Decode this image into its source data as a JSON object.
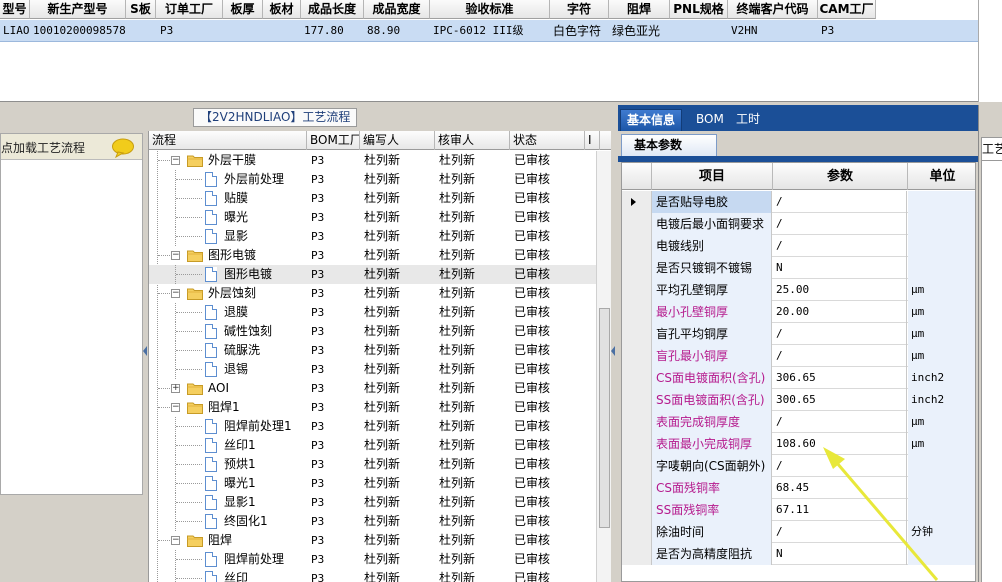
{
  "top_grid": {
    "headers": [
      "型号",
      "新生产型号",
      "S板",
      "订单工厂",
      "板厚",
      "板材",
      "成品长度",
      "成品宽度",
      "验收标准",
      "字符",
      "阻焊",
      "PNL规格",
      "终端客户代码",
      "CAM工厂"
    ],
    "row": [
      "LIAO",
      "10010200098578",
      "P3",
      "",
      "",
      "177.80",
      "88.90",
      "IPC-6012 III级",
      "白色字符",
      "绿色亚光",
      "",
      "V2HN",
      "P3"
    ]
  },
  "left_panel": {
    "title": "点加载工艺流程",
    "chat_icon": "speech-bubble-icon"
  },
  "flow_panel": {
    "title": "【2V2HNDLIAO】工艺流程",
    "headers": [
      "流程",
      "BOM工厂",
      "编写人",
      "核审人",
      "状态",
      "I"
    ],
    "rows": [
      {
        "label": "外层干膜",
        "kind": "folder",
        "level": 1,
        "factory": "P3",
        "writer": "杜列新",
        "reviewer": "杜列新",
        "status": "已审核"
      },
      {
        "label": "外层前处理",
        "kind": "doc",
        "level": 2,
        "factory": "P3",
        "writer": "杜列新",
        "reviewer": "杜列新",
        "status": "已审核"
      },
      {
        "label": "贴膜",
        "kind": "doc",
        "level": 2,
        "factory": "P3",
        "writer": "杜列新",
        "reviewer": "杜列新",
        "status": "已审核"
      },
      {
        "label": "曝光",
        "kind": "doc",
        "level": 2,
        "factory": "P3",
        "writer": "杜列新",
        "reviewer": "杜列新",
        "status": "已审核"
      },
      {
        "label": "显影",
        "kind": "doc",
        "level": 2,
        "factory": "P3",
        "writer": "杜列新",
        "reviewer": "杜列新",
        "status": "已审核"
      },
      {
        "label": "图形电镀",
        "kind": "folder",
        "level": 1,
        "factory": "P3",
        "writer": "杜列新",
        "reviewer": "杜列新",
        "status": "已审核"
      },
      {
        "label": "图形电镀",
        "kind": "doc",
        "level": 2,
        "factory": "P3",
        "writer": "杜列新",
        "reviewer": "杜列新",
        "status": "已审核",
        "selected": true
      },
      {
        "label": "外层蚀刻",
        "kind": "folder",
        "level": 1,
        "factory": "P3",
        "writer": "杜列新",
        "reviewer": "杜列新",
        "status": "已审核"
      },
      {
        "label": "退膜",
        "kind": "doc",
        "level": 2,
        "factory": "P3",
        "writer": "杜列新",
        "reviewer": "杜列新",
        "status": "已审核"
      },
      {
        "label": "碱性蚀刻",
        "kind": "doc",
        "level": 2,
        "factory": "P3",
        "writer": "杜列新",
        "reviewer": "杜列新",
        "status": "已审核"
      },
      {
        "label": "硫脲洗",
        "kind": "doc",
        "level": 2,
        "factory": "P3",
        "writer": "杜列新",
        "reviewer": "杜列新",
        "status": "已审核"
      },
      {
        "label": "退锡",
        "kind": "doc",
        "level": 2,
        "factory": "P3",
        "writer": "杜列新",
        "reviewer": "杜列新",
        "status": "已审核"
      },
      {
        "label": "AOI",
        "kind": "folder",
        "level": 1,
        "collapsed": true,
        "factory": "P3",
        "writer": "杜列新",
        "reviewer": "杜列新",
        "status": "已审核"
      },
      {
        "label": "阻焊1",
        "kind": "folder",
        "level": 1,
        "factory": "P3",
        "writer": "杜列新",
        "reviewer": "杜列新",
        "status": "已审核"
      },
      {
        "label": "阻焊前处理1",
        "kind": "doc",
        "level": 2,
        "factory": "P3",
        "writer": "杜列新",
        "reviewer": "杜列新",
        "status": "已审核"
      },
      {
        "label": "丝印1",
        "kind": "doc",
        "level": 2,
        "factory": "P3",
        "writer": "杜列新",
        "reviewer": "杜列新",
        "status": "已审核"
      },
      {
        "label": "预烘1",
        "kind": "doc",
        "level": 2,
        "factory": "P3",
        "writer": "杜列新",
        "reviewer": "杜列新",
        "status": "已审核"
      },
      {
        "label": "曝光1",
        "kind": "doc",
        "level": 2,
        "factory": "P3",
        "writer": "杜列新",
        "reviewer": "杜列新",
        "status": "已审核"
      },
      {
        "label": "显影1",
        "kind": "doc",
        "level": 2,
        "factory": "P3",
        "writer": "杜列新",
        "reviewer": "杜列新",
        "status": "已审核"
      },
      {
        "label": "终固化1",
        "kind": "doc",
        "level": 2,
        "factory": "P3",
        "writer": "杜列新",
        "reviewer": "杜列新",
        "status": "已审核"
      },
      {
        "label": "阻焊",
        "kind": "folder",
        "level": 1,
        "factory": "P3",
        "writer": "杜列新",
        "reviewer": "杜列新",
        "status": "已审核"
      },
      {
        "label": "阻焊前处理",
        "kind": "doc",
        "level": 2,
        "factory": "P3",
        "writer": "杜列新",
        "reviewer": "杜列新",
        "status": "已审核"
      },
      {
        "label": "丝印",
        "kind": "doc",
        "level": 2,
        "factory": "P3",
        "writer": "杜列新",
        "reviewer": "杜列新",
        "status": "已审核"
      }
    ]
  },
  "right_panel": {
    "tabs": [
      "基本信息",
      "BOM",
      "工时"
    ],
    "active_tab": "基本信息",
    "sub_tab": "基本参数",
    "headers": [
      "项目",
      "参数",
      "单位"
    ],
    "rows": [
      {
        "item": "是否贴导电胶",
        "value": "/",
        "unit": "",
        "red": false
      },
      {
        "item": "电镀后最小面铜要求",
        "value": "/",
        "unit": "",
        "red": false
      },
      {
        "item": "电镀线别",
        "value": "/",
        "unit": "",
        "red": false
      },
      {
        "item": "是否只镀铜不镀锡",
        "value": "N",
        "unit": "",
        "red": false
      },
      {
        "item": "平均孔壁铜厚",
        "value": "25.00",
        "unit": "μm",
        "red": false
      },
      {
        "item": "最小孔壁铜厚",
        "value": "20.00",
        "unit": "μm",
        "red": true
      },
      {
        "item": "盲孔平均铜厚",
        "value": "/",
        "unit": "μm",
        "red": false
      },
      {
        "item": "盲孔最小铜厚",
        "value": "/",
        "unit": "μm",
        "red": true
      },
      {
        "item": "CS面电镀面积(含孔)",
        "value": "306.65",
        "unit": "inch2",
        "red": true
      },
      {
        "item": "SS面电镀面积(含孔)",
        "value": "300.65",
        "unit": "inch2",
        "red": true
      },
      {
        "item": "表面完成铜厚度",
        "value": "/",
        "unit": "μm",
        "red": true
      },
      {
        "item": "表面最小完成铜厚",
        "value": "108.60",
        "unit": "μm",
        "red": true
      },
      {
        "item": "字唛朝向(CS面朝外)",
        "value": "/",
        "unit": "",
        "red": false
      },
      {
        "item": "CS面残铜率",
        "value": "68.45",
        "unit": "",
        "red": true
      },
      {
        "item": "SS面残铜率",
        "value": "67.11",
        "unit": "",
        "red": true
      },
      {
        "item": "除油时间",
        "value": "/",
        "unit": "分钟",
        "red": false
      },
      {
        "item": "是否为高精度阻抗",
        "value": "N",
        "unit": "",
        "red": false
      }
    ]
  },
  "far_right": {
    "tab_label": "工艺"
  },
  "colors": {
    "selection_row": "#c9dcf3",
    "tab_bar": "#1b4f97",
    "red_text": "#b51a8d",
    "annotation_arrow": "#e8e83a"
  }
}
